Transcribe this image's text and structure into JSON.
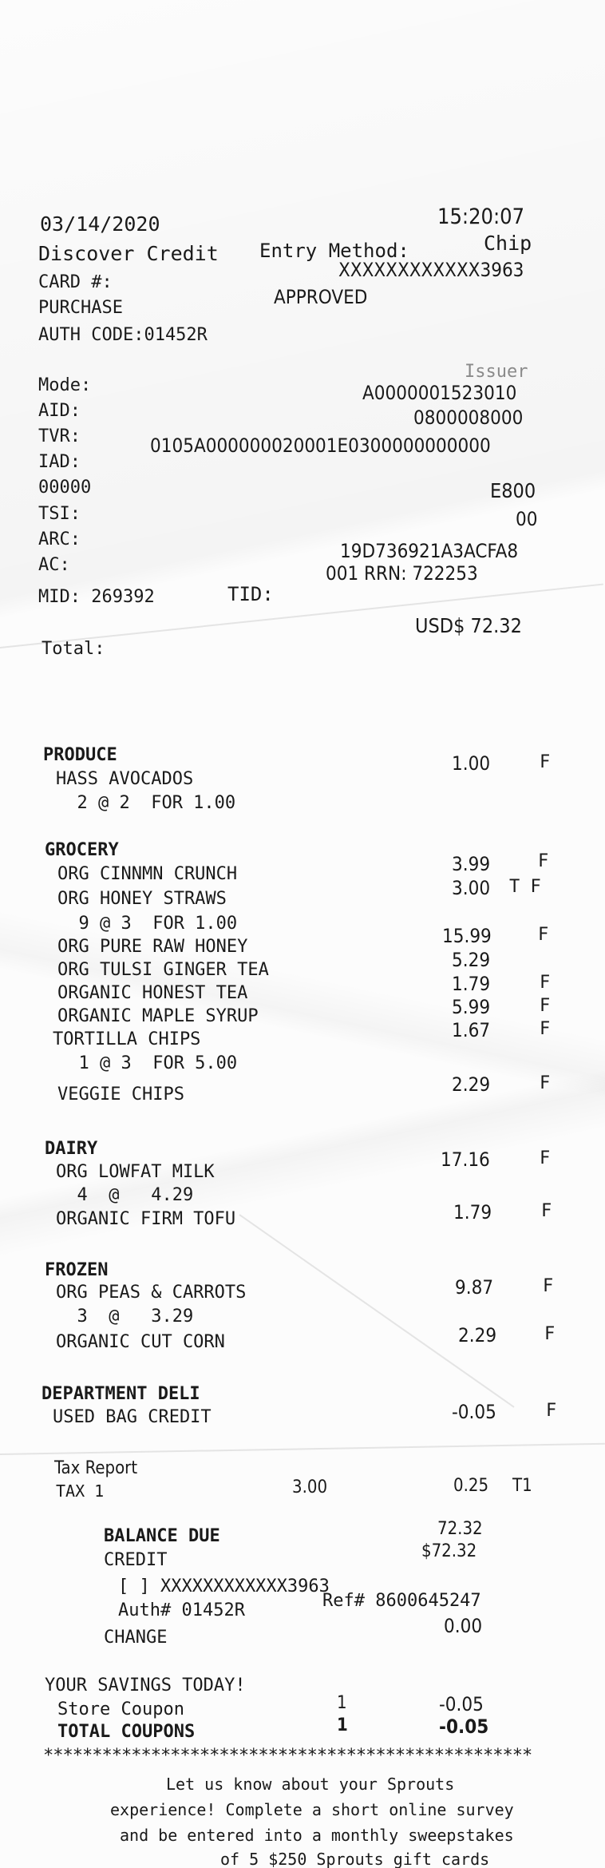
{
  "header": {
    "date": "03/14/2020",
    "time": "15:20:07",
    "card_type": "Discover Credit",
    "entry_method_label": "Entry Method:",
    "entry_method": "Chip",
    "card_label": "CARD #:",
    "card_number": "XXXXXXXXXXXX3963",
    "transaction": "PURCHASE",
    "status": "APPROVED",
    "auth_code": "AUTH CODE:01452R"
  },
  "emv": {
    "mode_label": "Mode:",
    "mode_value": "Issuer",
    "aid_label": "AID:",
    "aid_value": "A0000001523010",
    "tvr_label": "TVR:",
    "tvr_value": "0800008000",
    "iad_label": "IAD:",
    "iad_value": "0105A000000020001E0300000000000",
    "iad_cont": "00000",
    "tsi_label": "TSI:",
    "tsi_value": "E800",
    "arc_label": "ARC:",
    "arc_value": "00",
    "ac_label": "AC:",
    "ac_value": "19D736921A3ACFA8",
    "mid": "MID: 269392",
    "tid": "TID:",
    "rrn": "001 RRN: 722253",
    "total_label": "Total:",
    "total_value": "USD$ 72.32"
  },
  "sections": [
    {
      "name": "PRODUCE",
      "items": [
        {
          "desc": "HASS AVOCADOS",
          "price": "1.00",
          "flag": "F"
        },
        {
          "desc": "  2 @ 2  FOR 1.00",
          "price": "",
          "flag": ""
        }
      ]
    },
    {
      "name": "GROCERY",
      "items": [
        {
          "desc": "ORG CINNMN CRUNCH",
          "price": "3.99",
          "flag": "F"
        },
        {
          "desc": "ORG HONEY STRAWS",
          "price": "3.00",
          "flag": "T F"
        },
        {
          "desc": "  9 @ 3  FOR 1.00",
          "price": "",
          "flag": ""
        },
        {
          "desc": "ORG PURE RAW HONEY",
          "price": "15.99",
          "flag": "F"
        },
        {
          "desc": "ORG TULSI GINGER TEA",
          "price": "5.29",
          "flag": ""
        },
        {
          "desc": "ORGANIC HONEST TEA",
          "price": "1.79",
          "flag": "F"
        },
        {
          "desc": "ORGANIC MAPLE SYRUP",
          "price": "5.99",
          "flag": "F"
        },
        {
          "desc": "TORTILLA CHIPS",
          "price": "1.67",
          "flag": "F"
        },
        {
          "desc": "  1 @ 3  FOR 5.00",
          "price": "",
          "flag": ""
        },
        {
          "desc": "VEGGIE CHIPS",
          "price": "2.29",
          "flag": "F"
        }
      ]
    },
    {
      "name": "DAIRY",
      "items": [
        {
          "desc": "ORG LOWFAT MILK",
          "price": "17.16",
          "flag": "F"
        },
        {
          "desc": "  4  @   4.29",
          "price": "",
          "flag": ""
        },
        {
          "desc": "ORGANIC FIRM TOFU",
          "price": "1.79",
          "flag": "F"
        }
      ]
    },
    {
      "name": "FROZEN",
      "items": [
        {
          "desc": "ORG PEAS & CARROTS",
          "price": "9.87",
          "flag": "F"
        },
        {
          "desc": "  3  @   3.29",
          "price": "",
          "flag": ""
        },
        {
          "desc": "ORGANIC CUT CORN",
          "price": "2.29",
          "flag": "F"
        }
      ]
    },
    {
      "name": "DEPARTMENT DELI",
      "items": [
        {
          "desc": "USED BAG CREDIT",
          "price": "-0.05",
          "flag": "F"
        }
      ]
    }
  ],
  "tax": {
    "title": "Tax Report",
    "label": "TAX 1",
    "base": "3.00",
    "amount": "0.25",
    "flag": "T1"
  },
  "payment": {
    "balance_label": "BALANCE DUE",
    "balance_value": "72.32",
    "credit_label": "CREDIT",
    "credit_value": "$72.32",
    "card_line": "[ ] XXXXXXXXXXXX3963",
    "auth": "Auth# 01452R",
    "ref": "Ref# 8600645247",
    "change_label": "CHANGE",
    "change_value": "0.00"
  },
  "savings": {
    "title": "YOUR SAVINGS TODAY!",
    "rows": [
      {
        "label": "Store Coupon",
        "qty": "1",
        "value": "-0.05"
      },
      {
        "label": "TOTAL COUPONS",
        "qty": "1",
        "value": "-0.05"
      }
    ]
  },
  "footer": {
    "stars": "**************************************************",
    "lines": [
      "Let us know about your Sprouts",
      "experience! Complete a short online survey",
      "and be entered into a monthly sweepstakes",
      "of 5 $250 Sprouts gift cards"
    ]
  }
}
